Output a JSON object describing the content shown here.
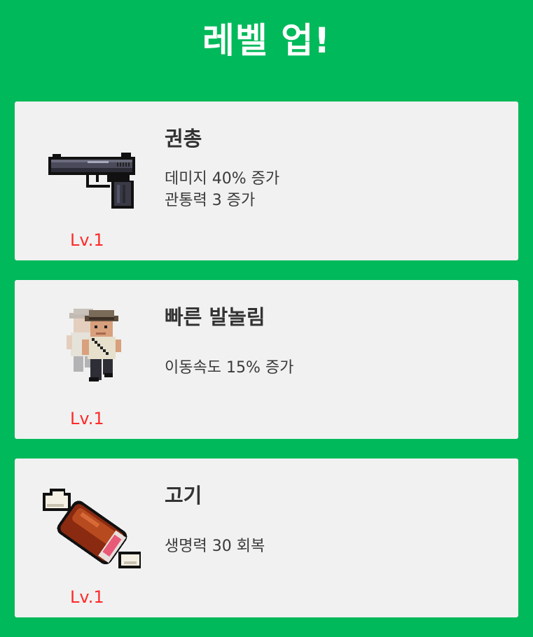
{
  "title": "레벨 업!",
  "cards": [
    {
      "icon": "pistol-icon",
      "name": "권총",
      "descriptions": [
        "데미지 40% 증가",
        "관통력 3 증가"
      ],
      "level": "Lv.1"
    },
    {
      "icon": "running-soldier-icon",
      "name": "빠른 발놀림",
      "descriptions": [
        "이동속도 15% 증가"
      ],
      "level": "Lv.1"
    },
    {
      "icon": "meat-icon",
      "name": "고기",
      "descriptions": [
        "생명력 30 회복"
      ],
      "level": "Lv.1"
    }
  ],
  "colors": {
    "background": "#00b95a",
    "card": "#f1f1f1",
    "level": "#ff2a2a"
  }
}
